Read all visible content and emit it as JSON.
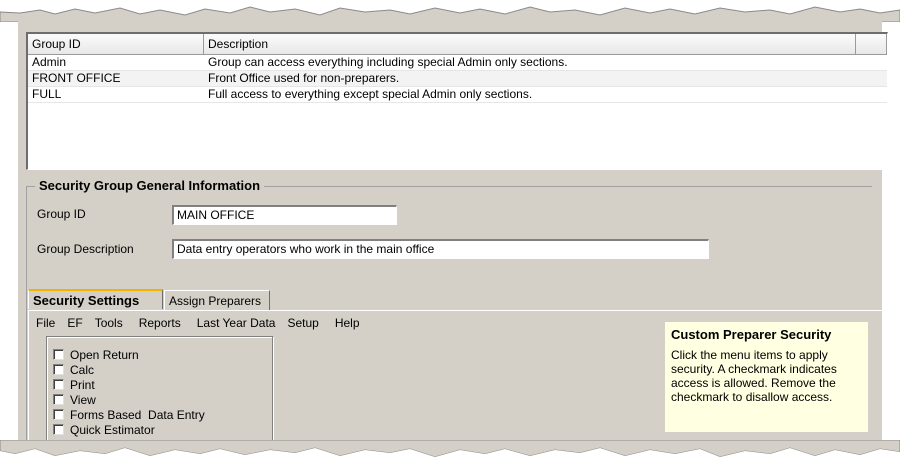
{
  "grid": {
    "columns": [
      "Group ID",
      "Description"
    ],
    "rows": [
      {
        "id": "Admin",
        "description": "Group can access everything including special Admin only sections."
      },
      {
        "id": "FRONT OFFICE",
        "description": "Front Office used for non-preparers."
      },
      {
        "id": "FULL",
        "description": "Full access to everything except special Admin only sections."
      }
    ]
  },
  "general_info": {
    "title": "Security Group General Information",
    "group_id_label": "Group ID",
    "group_id_value": "MAIN OFFICE",
    "group_desc_label": "Group Description",
    "group_desc_value": "Data entry operators who work in the main office"
  },
  "tabs": [
    "Security Settings",
    "Assign Preparers"
  ],
  "menu": [
    "File",
    "EF",
    "Tools",
    "Reports",
    "Last Year Data",
    "Setup",
    "Help"
  ],
  "checkbox_items": [
    "Open Return",
    "Calc",
    "Print",
    "View",
    "Forms Based  Data Entry",
    "Quick Estimator"
  ],
  "help": {
    "title": "Custom Preparer Security",
    "text": "Click the menu items to apply security. A checkmark indicates access is allowed. Remove the checkmark to disallow access."
  },
  "colors": {
    "window_bg": "#d4d0c8",
    "help_bg": "#ffffe1",
    "active_tab_accent": "#f0b400"
  }
}
